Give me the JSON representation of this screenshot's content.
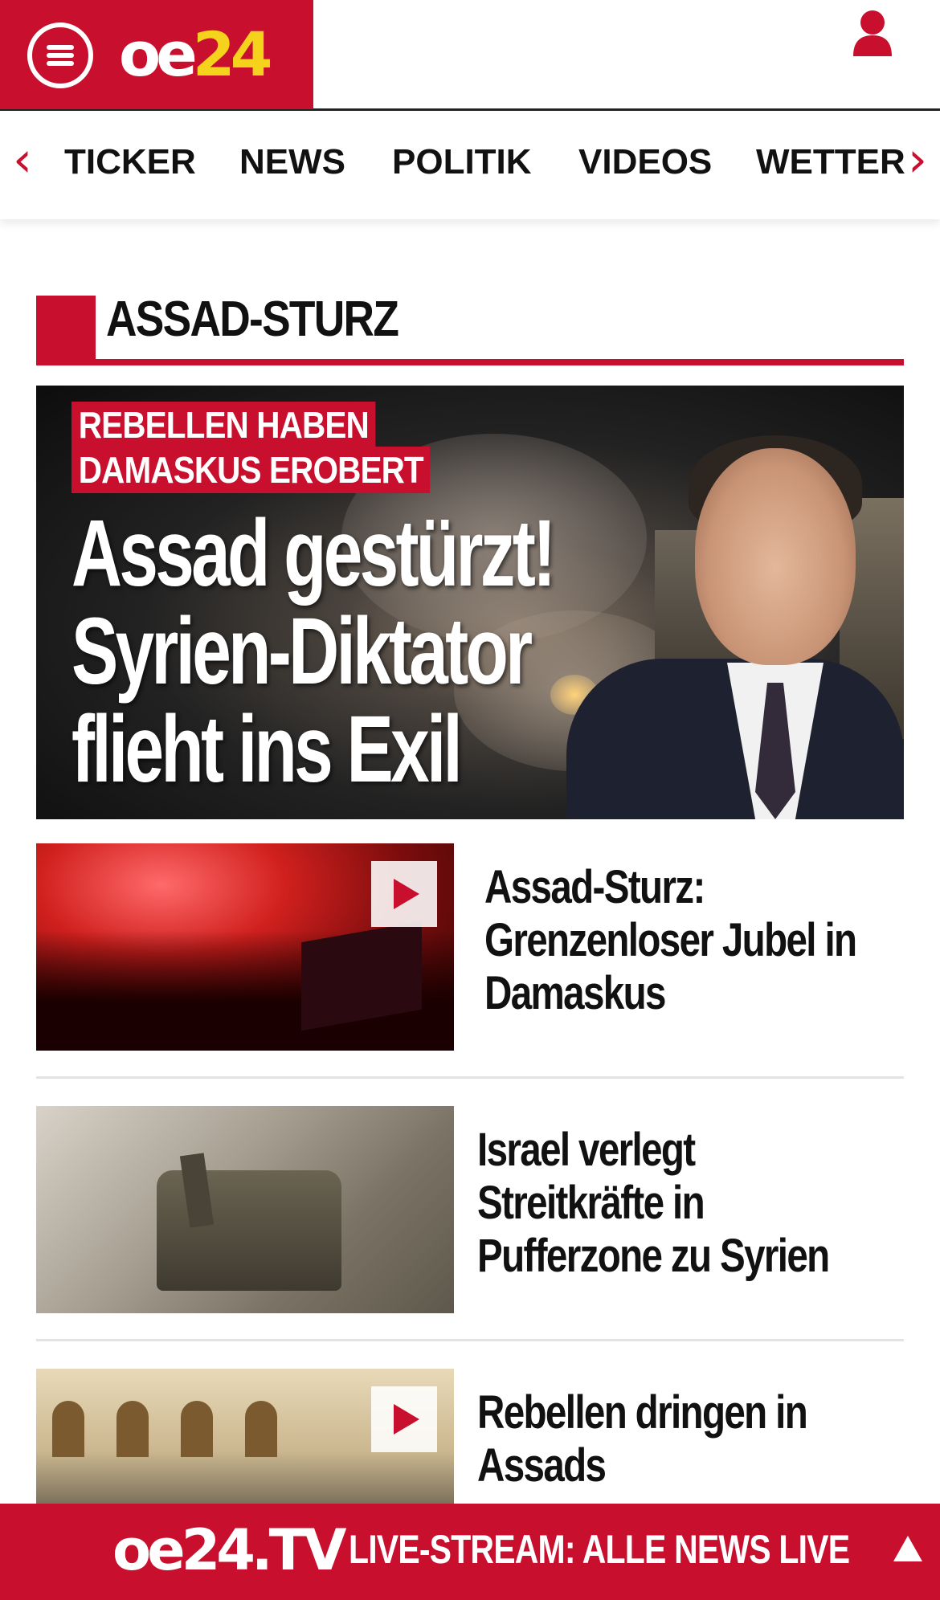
{
  "header": {
    "logo_oe": "oe",
    "logo_num": "24",
    "menu_icon": "hamburger-menu-icon",
    "user_icon": "user-icon"
  },
  "nav": {
    "items": [
      {
        "label": "TICKER"
      },
      {
        "label": "NEWS"
      },
      {
        "label": "POLITIK"
      },
      {
        "label": "VIDEOS"
      },
      {
        "label": "WETTER"
      }
    ],
    "left_arrow": "‹",
    "right_arrow": "›"
  },
  "section": {
    "title": "ASSAD-STURZ"
  },
  "hero": {
    "kicker_line1": "REBELLEN HABEN",
    "kicker_line2": "DAMASKUS EROBERT",
    "headline_line1": "Assad gestürzt!",
    "headline_line2": "Syrien-Diktator",
    "headline_line3": "flieht ins Exil"
  },
  "articles": [
    {
      "line1": "Assad-Sturz:",
      "line2": "Grenzenloser Jubel in",
      "line3": "Damaskus",
      "has_video": true
    },
    {
      "line1": "Israel verlegt",
      "line2": "Streitkräfte in",
      "line3": "Pufferzone zu Syrien",
      "has_video": false
    },
    {
      "line1": "Rebellen dringen in",
      "line2": "Assads",
      "line3": "",
      "has_video": true
    }
  ],
  "bottom_bar": {
    "logo": "oe24.TV",
    "text": "LIVE-STREAM:  ALLE NEWS LIVE"
  },
  "colors": {
    "brand_red": "#c8102e",
    "logo_yellow": "#f5d21c"
  }
}
